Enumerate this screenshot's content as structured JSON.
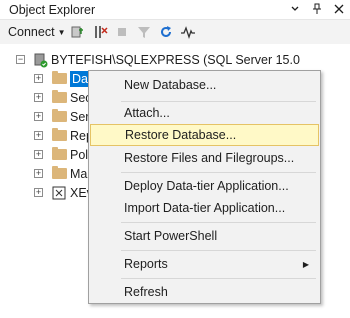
{
  "panel": {
    "title": "Object Explorer",
    "controls": [
      "pin-icon",
      "auto-hide-icon",
      "close-icon"
    ]
  },
  "toolbar": {
    "connect_label": "Connect",
    "icons": [
      "connect-server-icon",
      "disconnect-icon",
      "stop-icon",
      "filter-icon",
      "refresh-icon",
      "activity-monitor-icon"
    ]
  },
  "tree": {
    "server": "BYTEFISH\\SQLEXPRESS (SQL Server 15.0",
    "nodes": [
      {
        "label": "Datab",
        "selected": true
      },
      {
        "label": "Secu"
      },
      {
        "label": "Serv"
      },
      {
        "label": "Repl"
      },
      {
        "label": "Poly"
      },
      {
        "label": "Man"
      },
      {
        "label": "XEve"
      }
    ]
  },
  "context_menu": {
    "items": [
      {
        "label": "New Database..."
      },
      {
        "label": "Attach..."
      },
      {
        "label": "Restore Database...",
        "highlighted": true
      },
      {
        "label": "Restore Files and Filegroups..."
      },
      {
        "label": "Deploy Data-tier Application..."
      },
      {
        "label": "Import Data-tier Application..."
      },
      {
        "label": "Start PowerShell"
      },
      {
        "label": "Reports",
        "submenu": true
      },
      {
        "label": "Refresh"
      }
    ]
  },
  "colors": {
    "selection": "#0078d7",
    "menu_highlight": "#fff9c7",
    "menu_highlight_border": "#e5c365",
    "folder": "#dcb67a"
  }
}
